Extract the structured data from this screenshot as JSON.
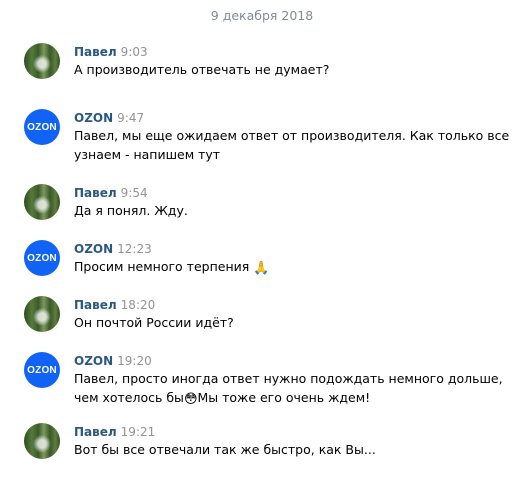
{
  "date_divider": "9 декабря 2018",
  "messages": [
    {
      "author": "Павел",
      "time": "9:03",
      "text": "А производитель отвечать не думает?",
      "avatar": "pavel-photo"
    },
    {
      "author": "OZON",
      "time": "9:47",
      "text": "Павел, мы еще ожидаем ответ от производителя. Как только все узнаем - напишем тут",
      "avatar": "ozon-logo"
    },
    {
      "author": "Павел",
      "time": "9:54",
      "text": "Да я понял. Жду.",
      "avatar": "pavel-photo"
    },
    {
      "author": "OZON",
      "time": "12:23",
      "text": "Просим немного терпения",
      "emoji": "🙏",
      "avatar": "ozon-logo"
    },
    {
      "author": "Павел",
      "time": "18:20",
      "text": "Он почтой России идёт?",
      "avatar": "pavel-photo"
    },
    {
      "author": "OZON",
      "time": "19:20",
      "text_before": "Павел, просто иногда ответ нужно подождать немного дольше, чем хотелось бы",
      "emoji": "😳",
      "text_after": "Мы тоже его очень ждем!",
      "avatar": "ozon-logo"
    },
    {
      "author": "Павел",
      "time": "19:21",
      "text": "Вот бы все отвечали так же быстро, как Вы...",
      "avatar": "pavel-photo"
    }
  ],
  "ozon_logo_text": "OZON",
  "colors": {
    "author_name": "#2a5885",
    "timestamp": "#939393",
    "date_divider": "#818c99",
    "ozon_brand": "#1063f5"
  }
}
